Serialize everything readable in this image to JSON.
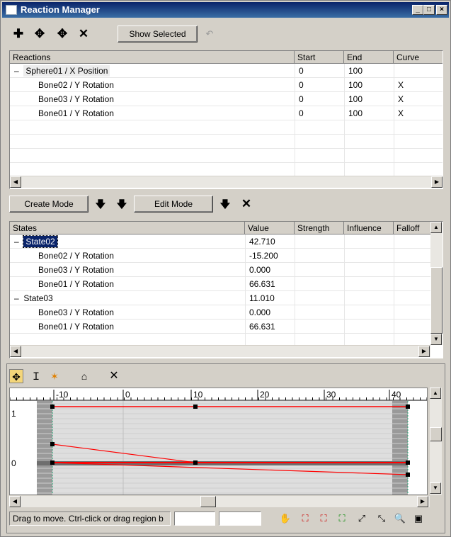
{
  "window": {
    "title": "Reaction Manager",
    "minimize": "_",
    "maximize": "□",
    "close": "×"
  },
  "toolbar": {
    "add_master": "✚",
    "add_selected": "✥",
    "add_slave": "✥",
    "delete": "✕",
    "show_selected": "Show Selected",
    "undo": "↶"
  },
  "reactions": {
    "columns": [
      "Reactions",
      "Start",
      "End",
      "Curve"
    ],
    "rows": [
      {
        "name": "Sphere01 / X Position",
        "start": "0",
        "end": "100",
        "curve": "",
        "expander": "–"
      },
      {
        "name": "Bone02 / Y Rotation",
        "start": "0",
        "end": "100",
        "curve": "X",
        "expander": ""
      },
      {
        "name": "Bone03 / Y Rotation",
        "start": "0",
        "end": "100",
        "curve": "X",
        "expander": ""
      },
      {
        "name": "Bone01 / Y Rotation",
        "start": "0",
        "end": "100",
        "curve": "X",
        "expander": ""
      }
    ]
  },
  "mode_bar": {
    "create_mode": "Create Mode",
    "edit_mode": "Edit Mode",
    "arrow1": "🡇",
    "arrow2": "🡇",
    "arrow3": "🡇",
    "delete": "✕"
  },
  "states": {
    "columns": [
      "States",
      "Value",
      "Strength",
      "Influence",
      "Falloff"
    ],
    "rows": [
      {
        "name": "State02",
        "value": "42.710",
        "expander": "–",
        "selected": true
      },
      {
        "name": "Bone02 / Y Rotation",
        "value": "-15.200",
        "expander": ""
      },
      {
        "name": "Bone03 / Y Rotation",
        "value": "0.000",
        "expander": ""
      },
      {
        "name": "Bone01 / Y Rotation",
        "value": "66.631",
        "expander": ""
      },
      {
        "name": "State03",
        "value": "11.010",
        "expander": "–"
      },
      {
        "name": "Bone03 / Y Rotation",
        "value": "0.000",
        "expander": ""
      },
      {
        "name": "Bone01 / Y Rotation",
        "value": "66.631",
        "expander": ""
      }
    ]
  },
  "curve_editor": {
    "ruler_labels": [
      "-10",
      "0",
      "10",
      "20",
      "30",
      "40"
    ],
    "y_labels": [
      "1",
      "0"
    ],
    "tools": {
      "move": "✥",
      "scale": "Ｉ",
      "insert": "✶",
      "pan": "⌂",
      "delete": "✕"
    }
  },
  "statusbar": {
    "text": "Drag to move. Ctrl-click or drag region b",
    "field1": "",
    "field2": "",
    "icons": [
      "hand-icon",
      "zoom-extents-icon",
      "zoom-horizontal-icon",
      "zoom-value-icon",
      "zoom-icon",
      "zoom-region-icon"
    ]
  },
  "colors": {
    "title_start": "#0a246a",
    "title_end": "#3a6ea5",
    "selection": "#0a246a",
    "curve": "#ff0000",
    "grid_bg": "#dedede"
  }
}
